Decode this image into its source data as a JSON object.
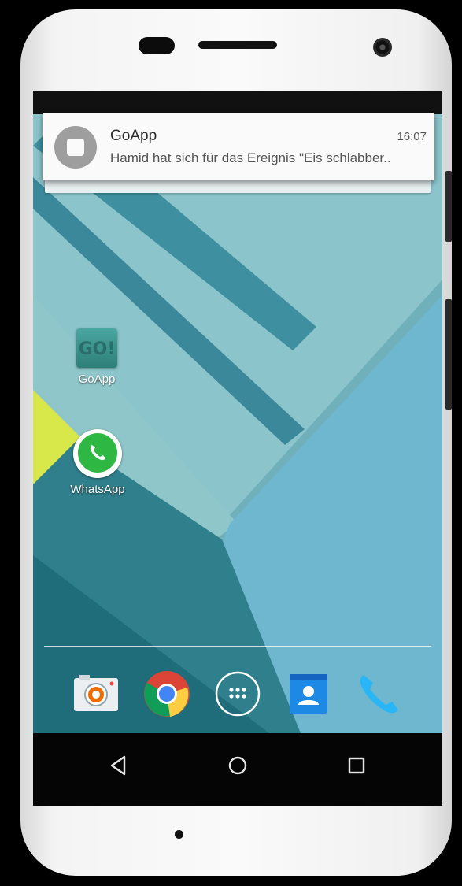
{
  "notification": {
    "app_name": "GoApp",
    "time": "16:07",
    "text": "Hamid hat sich für das Ereignis \"Eis schlabber.."
  },
  "home": {
    "apps": [
      {
        "label": "GoApp",
        "icon": "goapp-icon",
        "icon_text": "GO!"
      },
      {
        "label": "WhatsApp",
        "icon": "whatsapp-icon"
      }
    ]
  },
  "dock": [
    {
      "icon": "camera-icon"
    },
    {
      "icon": "chrome-icon"
    },
    {
      "icon": "app-drawer-icon"
    },
    {
      "icon": "contacts-icon"
    },
    {
      "icon": "phone-icon"
    }
  ],
  "navbar": [
    "back-icon",
    "home-icon",
    "recents-icon"
  ],
  "colors": {
    "wallpaper_teal": "#2f7f8c",
    "wallpaper_light": "#8ac3cc",
    "accent_yellow": "#d8e84a",
    "whatsapp_green": "#2fb743"
  }
}
